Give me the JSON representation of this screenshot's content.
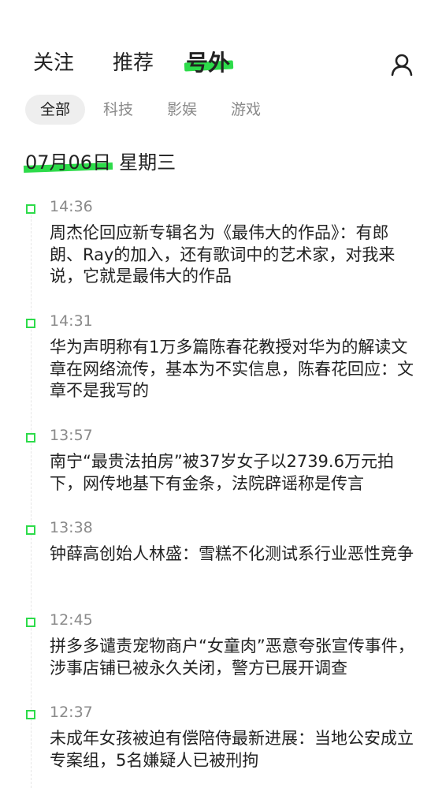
{
  "topnav": {
    "tabs": [
      {
        "label": "关注"
      },
      {
        "label": "推荐"
      },
      {
        "label": "号外",
        "active": true
      }
    ],
    "user_icon": "user-icon"
  },
  "categories": [
    {
      "label": "全部",
      "active": true
    },
    {
      "label": "科技"
    },
    {
      "label": "影娱"
    },
    {
      "label": "游戏"
    }
  ],
  "date_header": {
    "date": "07月06日",
    "weekday": "星期三"
  },
  "accent_color": "#2ddb4a",
  "news": [
    {
      "time": "14:36",
      "title": "周杰伦回应新专辑名为《最伟大的作品》：有郎朗、Ray的加入，还有歌词中的艺术家，对我来说，它就是最伟大的作品"
    },
    {
      "time": "14:31",
      "title": "华为声明称有1万多篇陈春花教授对华为的解读文章在网络流传，基本为不实信息，陈春花回应：文章不是我写的"
    },
    {
      "time": "13:57",
      "title": "南宁“最贵法拍房”被37岁女子以2739.6万元拍下，网传地基下有金条，法院辟谣称是传言"
    },
    {
      "time": "13:38",
      "title": "钟薛高创始人林盛：雪糕不化测试系行业恶性竞争"
    },
    {
      "time": "12:45",
      "title": "拼多多谴责宠物商户“女童肉”恶意夸张宣传事件，涉事店铺已被永久关闭，警方已展开调查"
    },
    {
      "time": "12:37",
      "title": "未成年女孩被迫有偿陪侍最新进展：当地公安成立专案组，5名嫌疑人已被刑拘"
    }
  ]
}
